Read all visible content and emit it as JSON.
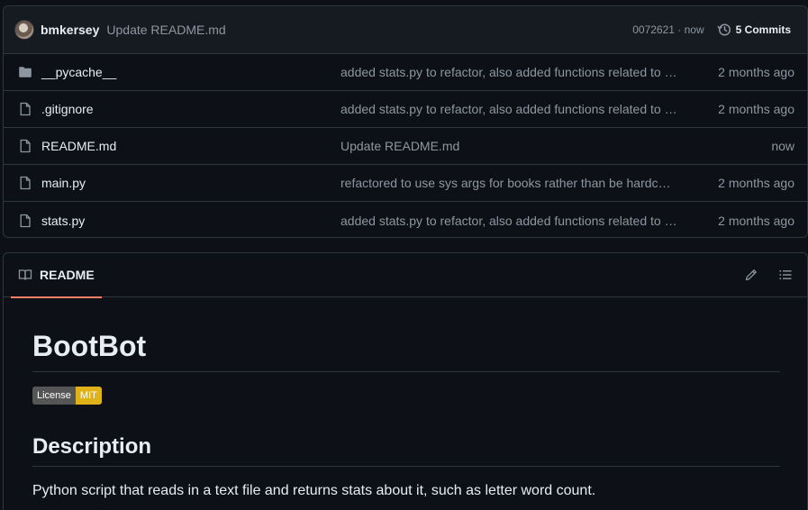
{
  "latest_commit": {
    "author": "bmkersey",
    "message": "Update README.md",
    "hash_time": "0072621 · now",
    "commits_label": "5 Commits"
  },
  "files": [
    {
      "type": "folder",
      "name": "__pycache__",
      "commit": "added stats.py to refactor, also added functions related to a…",
      "age": "2 months ago"
    },
    {
      "type": "file",
      "name": ".gitignore",
      "commit": "added stats.py to refactor, also added functions related to a…",
      "age": "2 months ago"
    },
    {
      "type": "file",
      "name": "README.md",
      "commit": "Update README.md",
      "age": "now"
    },
    {
      "type": "file",
      "name": "main.py",
      "commit": "refactored to use sys args for books rather than be hardcod…",
      "age": "2 months ago"
    },
    {
      "type": "file",
      "name": "stats.py",
      "commit": "added stats.py to refactor, also added functions related to a…",
      "age": "2 months ago"
    }
  ],
  "readme": {
    "tab_label": "README",
    "title": "BootBot",
    "badge_left": "License",
    "badge_right": "MIT",
    "section_heading": "Description",
    "description": "Python script that reads in a text file and returns stats about it, such as letter word count."
  },
  "icons": {
    "folder": "folder-icon",
    "file": "file-icon",
    "history": "history-icon",
    "book": "book-icon",
    "pencil": "pencil-icon",
    "outline": "list-outline-icon"
  },
  "colors": {
    "background": "#0d1117",
    "header": "#161b22",
    "border": "#30363d",
    "muted": "#8d96a0",
    "accent": "#f78166",
    "badge_gray": "#555555",
    "badge_yellow": "#dfb317"
  }
}
